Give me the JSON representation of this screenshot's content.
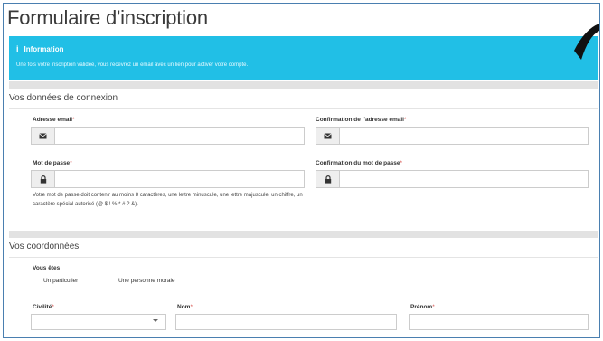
{
  "form": {
    "title": "Formulaire d'inscription"
  },
  "info": {
    "icon": "info-icon",
    "heading": "Information",
    "text": "Une fois votre inscription validée, vous recevrez un email avec un lien pour activer votre compte."
  },
  "connexion": {
    "title": "Vos données de connexion",
    "email_label": "Adresse email",
    "email_confirm_label": "Confirmation de l'adresse email",
    "password_label": "Mot de passe",
    "password_confirm_label": "Confirmation du mot de passe",
    "required_mark": "*",
    "password_hint": "Votre mot de passe doit contenir au moins 8 caractères, une lettre minuscule, une lettre majuscule, un chiffre, un caractère spécial autorisé (@ $ ! % * # ? &)."
  },
  "coordonnees": {
    "title": "Vos coordonnées",
    "vous_etes_label": "Vous êtes",
    "options": [
      "Un particulier",
      "Une personne morale"
    ],
    "civilite_label": "Civilité",
    "nom_label": "Nom",
    "prenom_label": "Prénom",
    "civilite_value": ""
  },
  "colors": {
    "info_bg": "#21bfe6",
    "required": "#d9534f",
    "border": "#cccccc"
  }
}
